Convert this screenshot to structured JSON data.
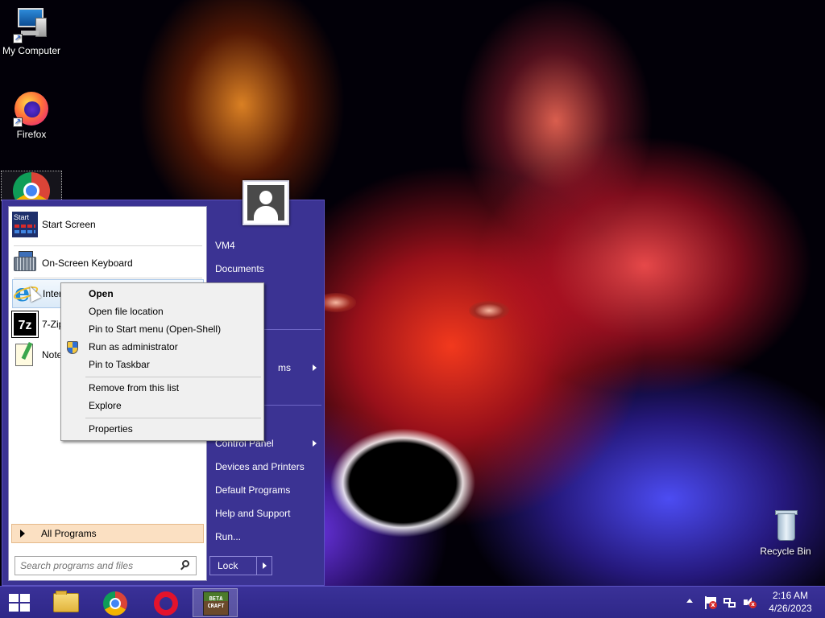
{
  "desktop": {
    "icons": [
      {
        "label": "My Computer"
      },
      {
        "label": "Firefox"
      },
      {
        "label": "Recycle Bin"
      }
    ]
  },
  "start_menu": {
    "programs": [
      {
        "label": "Start Screen",
        "icon": "start-screen-icon"
      },
      {
        "label": "On-Screen Keyboard",
        "icon": "keyboard-icon"
      },
      {
        "label": "Inter",
        "icon": "internet-explorer-icon"
      },
      {
        "label": "7-Zip",
        "icon": "7zip-icon"
      },
      {
        "label": "Note",
        "icon": "notepad-plus-icon"
      }
    ],
    "all_programs": "All Programs",
    "search_placeholder": "Search programs and files",
    "right_items": [
      {
        "label": "VM4",
        "submenu": false
      },
      {
        "label": "Documents",
        "submenu": false
      },
      {
        "label": "ms",
        "submenu": true
      },
      {
        "label": "Control Panel",
        "submenu": true
      },
      {
        "label": "Devices and Printers",
        "submenu": false
      },
      {
        "label": "Default Programs",
        "submenu": false
      },
      {
        "label": "Help and Support",
        "submenu": false
      },
      {
        "label": "Run...",
        "submenu": false
      }
    ],
    "lock_label": "Lock"
  },
  "context_menu": {
    "items": [
      {
        "label": "Open",
        "bold": true
      },
      {
        "label": "Open file location"
      },
      {
        "label": "Pin to Start menu (Open-Shell)"
      },
      {
        "label": "Run as administrator",
        "icon": "shield-icon"
      },
      {
        "label": "Pin to Taskbar"
      },
      {
        "label": "Remove from this list"
      },
      {
        "label": "Explore"
      },
      {
        "label": "Properties"
      }
    ]
  },
  "taskbar": {
    "pinned": [
      {
        "name": "file-explorer"
      },
      {
        "name": "chrome"
      },
      {
        "name": "opera"
      },
      {
        "name": "minecraft-beta",
        "glyph_text": "BETA CRAFT",
        "active": true
      }
    ],
    "clock": {
      "time": "2:16 AM",
      "date": "4/26/2023"
    }
  },
  "colors": {
    "start_menu_bg": "#3b3393",
    "taskbar_bg": "#3a3198",
    "all_programs_bg": "#fbe0c2"
  }
}
